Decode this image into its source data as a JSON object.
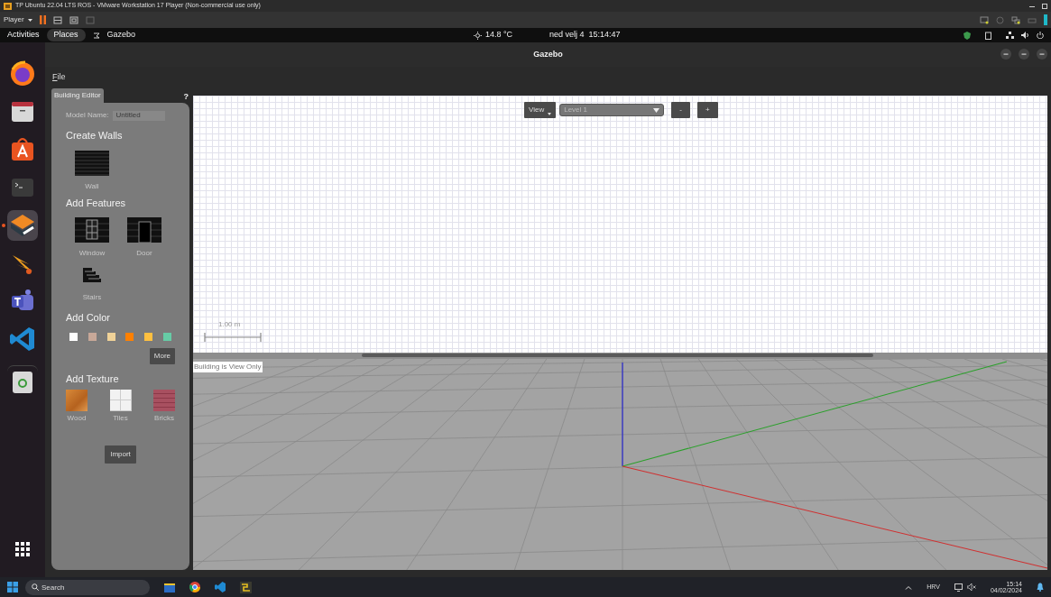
{
  "vm_window": {
    "title": "TP Ubuntu 22.04 LTS ROS - VMware Workstation 17 Player (Non-commercial use only)",
    "player_menu": "Player"
  },
  "top_bar": {
    "activities": "Activities",
    "places": "Places",
    "app": "Gazebo",
    "weather": "14.8 °C",
    "clock": "ned velj 4  15:14:47"
  },
  "dock": {
    "items": [
      {
        "kind": "firefox",
        "selected": false
      },
      {
        "kind": "files",
        "selected": false
      },
      {
        "kind": "software",
        "selected": false
      },
      {
        "kind": "terminal",
        "selected": false
      },
      {
        "kind": "gazebo",
        "selected": true
      },
      {
        "kind": "flame",
        "selected": false
      },
      {
        "kind": "teams",
        "selected": false
      },
      {
        "kind": "vscode",
        "selected": false
      },
      {
        "kind": "trash",
        "selected": false
      },
      {
        "kind": "apps",
        "selected": false
      }
    ]
  },
  "app_window": {
    "title": "Gazebo",
    "menu": [
      "File"
    ]
  },
  "building_editor": {
    "tab": "Building Editor",
    "help": "?",
    "model_name_label": "Model Name:",
    "model_name": "Untitled",
    "sections": [
      {
        "title": "Create Walls",
        "tools": [
          {
            "label": "Wall",
            "kind": "wall"
          }
        ]
      },
      {
        "title": "Add Features",
        "tools": [
          {
            "label": "Window",
            "kind": "window"
          },
          {
            "label": "Door",
            "kind": "door"
          },
          {
            "label": "Stairs",
            "kind": "stairs"
          }
        ]
      }
    ],
    "add_color": {
      "title": "Add Color",
      "colors": [
        {
          "color": "#ffffff"
        },
        {
          "color": "#c8a898"
        },
        {
          "color": "#f0d298"
        },
        {
          "color": "#ff8000"
        },
        {
          "color": "#ffc040"
        },
        {
          "color": "#66cca6"
        }
      ],
      "more_button": "More"
    },
    "add_texture": {
      "title": "Add Texture",
      "textures": [
        {
          "label": "Wood",
          "kind": "wood"
        },
        {
          "label": "Tiles",
          "kind": "tiles"
        },
        {
          "label": "Bricks",
          "kind": "bricks"
        }
      ]
    },
    "import_button": "Import"
  },
  "editor_2d": {
    "view_button": "View",
    "level": "Level 1",
    "minus_button": "-",
    "plus_button": "+",
    "scale": "1.00 m"
  },
  "view_3d": {
    "notice": "Building is View Only"
  },
  "taskbar": {
    "search_placeholder": "Search",
    "language": "HRV",
    "time": "15:14",
    "date": "04/02/2024"
  }
}
